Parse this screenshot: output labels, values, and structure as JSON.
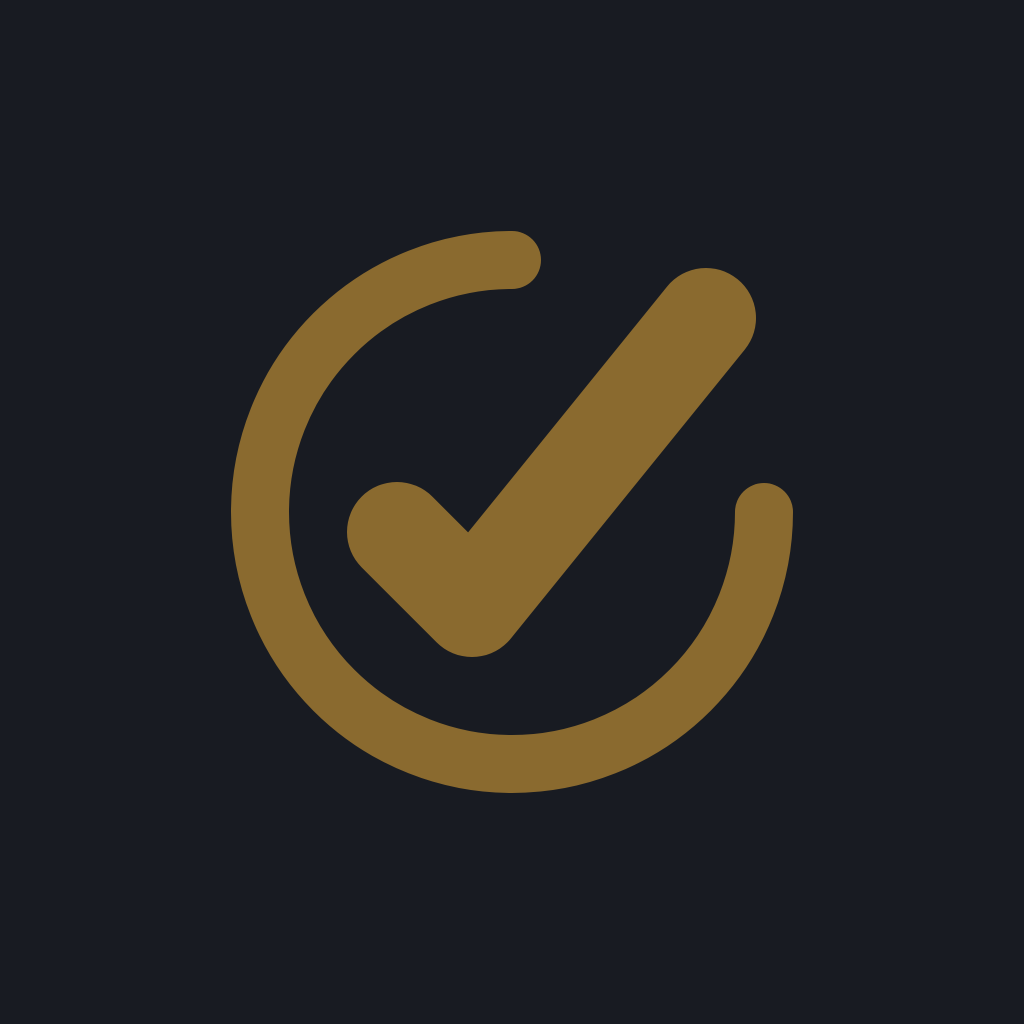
{
  "colors": {
    "background": "#181B22",
    "accent": "#8A6A2F"
  },
  "icon": {
    "name": "check-circle-icon"
  }
}
